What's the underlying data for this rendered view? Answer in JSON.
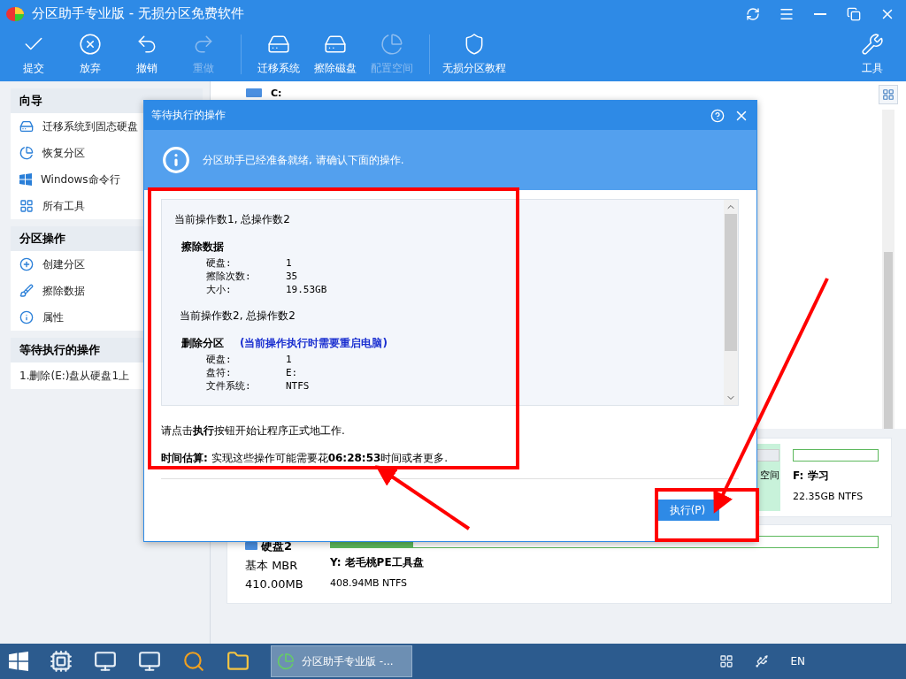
{
  "window": {
    "title": "分区助手专业版 - 无损分区免费软件"
  },
  "toolbar": [
    {
      "label": "提交",
      "disabled": false
    },
    {
      "label": "放弃",
      "disabled": false
    },
    {
      "label": "撤销",
      "disabled": false
    },
    {
      "label": "重做",
      "disabled": true
    },
    {
      "label": "迁移系统",
      "disabled": false
    },
    {
      "label": "擦除磁盘",
      "disabled": false
    },
    {
      "label": "配置空间",
      "disabled": true
    },
    {
      "label": "无损分区教程",
      "disabled": false
    }
  ],
  "tools_button": {
    "label": "工具"
  },
  "sidebar": [
    {
      "title": "向导",
      "items": [
        {
          "label": "迁移系统到固态硬盘"
        },
        {
          "label": "恢复分区"
        },
        {
          "label": "Windows命令行"
        },
        {
          "label": "所有工具"
        }
      ]
    },
    {
      "title": "分区操作",
      "items": [
        {
          "label": "创建分区"
        },
        {
          "label": "擦除数据"
        },
        {
          "label": "属性"
        }
      ]
    },
    {
      "title": "等待执行的操作",
      "items": [
        {
          "label": "1.删除(E:)盘从硬盘1上"
        }
      ]
    }
  ],
  "partition_list": {
    "first_row": "C:"
  },
  "disks": [
    {
      "partitions": [
        {
          "detail": "空间",
          "kind": "unallocated"
        },
        {
          "label": "F: 学习",
          "detail": "22.35GB NTFS",
          "kind": "partition"
        }
      ]
    },
    {
      "name": "硬盘2",
      "type": "基本 MBR",
      "size": "410.00MB",
      "partitions": [
        {
          "label": "Y: 老毛桃PE工具盘",
          "detail": "408.94MB NTFS",
          "kind": "partition",
          "level": 0.15
        }
      ]
    }
  ],
  "dialog": {
    "title": "等待执行的操作",
    "banner": "分区助手已经准备就绪, 请确认下面的操作.",
    "operations": [
      {
        "header": "当前操作数1, 总操作数2",
        "title": "擦除数据",
        "fields": [
          {
            "label": "硬盘:",
            "value": "1"
          },
          {
            "label": "擦除次数:",
            "value": "35"
          },
          {
            "label": "大小:",
            "value": "19.53GB"
          }
        ]
      },
      {
        "header": "当前操作数2, 总操作数2",
        "title": "删除分区",
        "note": "(当前操作执行时需要重启电脑)",
        "fields": [
          {
            "label": "硬盘:",
            "value": "1"
          },
          {
            "label": "盘符:",
            "value": "E:"
          },
          {
            "label": "文件系统:",
            "value": "NTFS"
          }
        ]
      }
    ],
    "instruction": "请点击**执行**按钮开始让程序正式地工作.",
    "estimate": "**时间估算:** 实现这些操作可能需要花**06:28:53**时间或者更多.",
    "execute_button": "执行(P)"
  },
  "taskbar": {
    "app_button": "分区助手专业版 -...",
    "language": "EN"
  }
}
